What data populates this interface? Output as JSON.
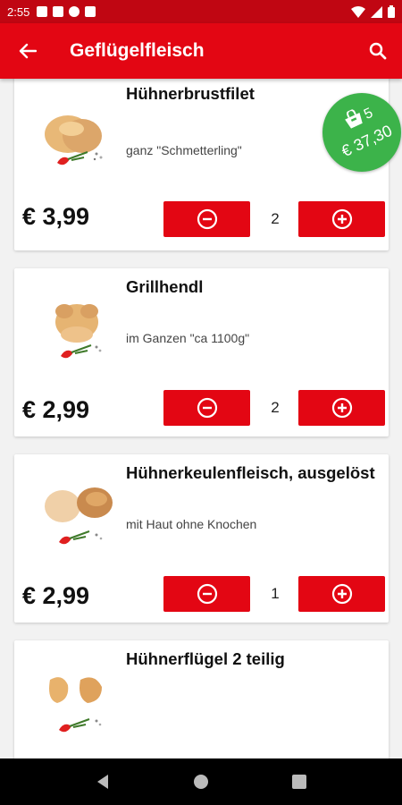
{
  "status_bar": {
    "time": "2:55"
  },
  "app_bar": {
    "title": "Geflügelfleisch"
  },
  "cart": {
    "count": "5",
    "total": "€ 37,30"
  },
  "products": [
    {
      "name": "Hühnerbrustfilet",
      "description": "ganz \"Schmetterling\"",
      "price": "€ 3,99",
      "quantity": "2"
    },
    {
      "name": "Grillhendl",
      "description": "im Ganzen \"ca 1100g\"",
      "price": "€ 2,99",
      "quantity": "2"
    },
    {
      "name": "Hühnerkeulenfleisch, ausgelöst",
      "description": "mit Haut ohne Knochen",
      "price": "€ 2,99",
      "quantity": "1"
    },
    {
      "name": "Hühnerflügel 2 teilig"
    }
  ],
  "colors": {
    "brand_red": "#e30613",
    "status_red": "#c00612",
    "cart_green": "#3cb34a"
  },
  "icons": [
    "back-arrow-icon",
    "search-icon",
    "shopping-bag-icon",
    "minus-circle-icon",
    "plus-circle-icon",
    "nav-back-icon",
    "nav-home-icon",
    "nav-recents-icon"
  ]
}
